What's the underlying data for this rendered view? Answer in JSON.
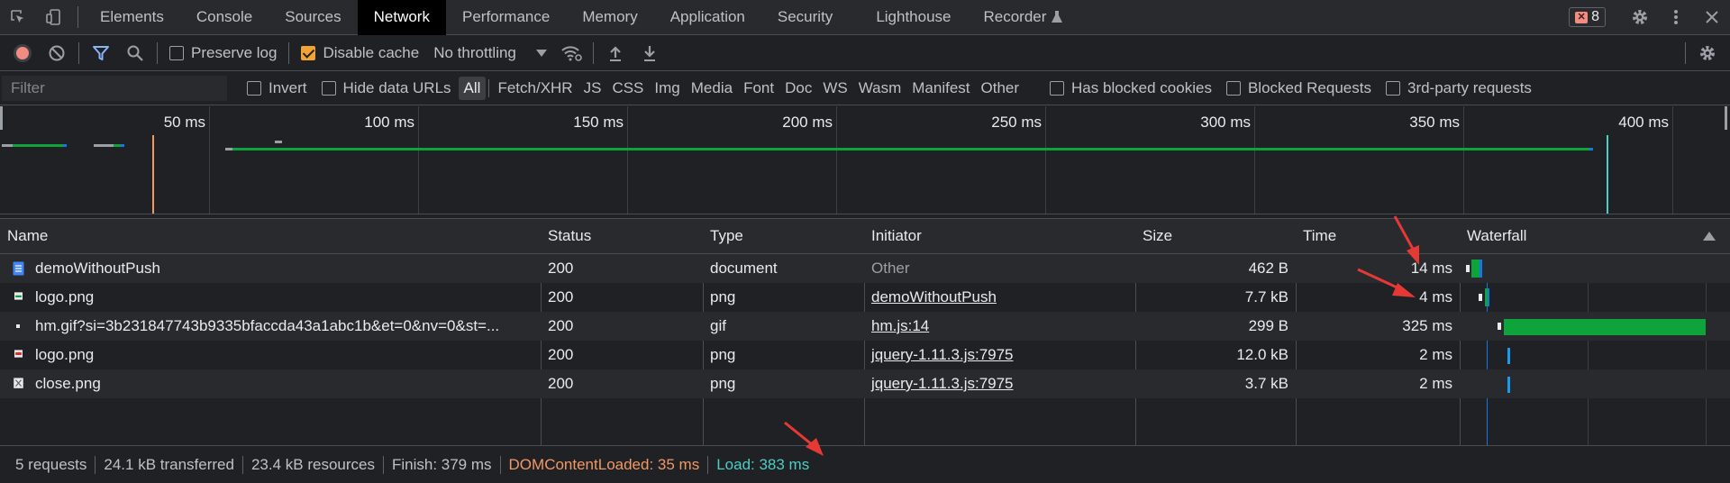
{
  "tabs": [
    {
      "label": "Elements",
      "name": "tab-elements"
    },
    {
      "label": "Console",
      "name": "tab-console"
    },
    {
      "label": "Sources",
      "name": "tab-sources"
    },
    {
      "label": "Network",
      "name": "tab-network"
    },
    {
      "label": "Performance",
      "name": "tab-performance"
    },
    {
      "label": "Memory",
      "name": "tab-memory"
    },
    {
      "label": "Application",
      "name": "tab-application"
    },
    {
      "label": "Security",
      "name": "tab-security"
    },
    {
      "label": "Lighthouse",
      "name": "tab-lighthouse"
    },
    {
      "label": "Recorder",
      "name": "tab-recorder"
    }
  ],
  "active_tab": "Network",
  "error_count": "8",
  "toolbar": {
    "preserve_log": "Preserve log",
    "disable_cache": "Disable cache",
    "throttling": "No throttling"
  },
  "filter": {
    "placeholder": "Filter",
    "invert": "Invert",
    "hide_data_urls": "Hide data URLs",
    "types": [
      "All",
      "Fetch/XHR",
      "JS",
      "CSS",
      "Img",
      "Media",
      "Font",
      "Doc",
      "WS",
      "Wasm",
      "Manifest",
      "Other"
    ],
    "has_blocked_cookies": "Has blocked cookies",
    "blocked_requests": "Blocked Requests",
    "third_party": "3rd-party requests"
  },
  "overview_ticks": [
    "50 ms",
    "100 ms",
    "150 ms",
    "200 ms",
    "250 ms",
    "300 ms",
    "350 ms",
    "400 ms"
  ],
  "columns": [
    "Name",
    "Status",
    "Type",
    "Initiator",
    "Size",
    "Time",
    "Waterfall"
  ],
  "rows": [
    {
      "name": "demoWithoutPush",
      "status": "200",
      "type": "document",
      "initiator": "Other",
      "size": "462 B",
      "time": "14 ms",
      "icon": "document-icon"
    },
    {
      "name": "logo.png",
      "status": "200",
      "type": "png",
      "initiator": "demoWithoutPush",
      "size": "7.7 kB",
      "time": "4 ms",
      "icon": "image-icon"
    },
    {
      "name": "hm.gif?si=3b231847743b9335bfaccda43a1abc1b&et=0&nv=0&st=...",
      "status": "200",
      "type": "gif",
      "initiator": "hm.js:14",
      "size": "299 B",
      "time": "325 ms",
      "icon": "gif-icon"
    },
    {
      "name": "logo.png",
      "status": "200",
      "type": "png",
      "initiator": "jquery-1.11.3.js:7975",
      "size": "12.0 kB",
      "time": "2 ms",
      "icon": "image-icon"
    },
    {
      "name": "close.png",
      "status": "200",
      "type": "png",
      "initiator": "jquery-1.11.3.js:7975",
      "size": "3.7 kB",
      "time": "2 ms",
      "icon": "close-image-icon"
    }
  ],
  "status": {
    "requests": "5 requests",
    "transferred": "24.1 kB transferred",
    "resources": "23.4 kB resources",
    "finish": "Finish: 379 ms",
    "dcl": "DOMContentLoaded: 35 ms",
    "load": "Load: 383 ms"
  },
  "colors": {
    "accent": "#8ab4f8",
    "record": "#f28b82",
    "checkbox_on": "#f2a336",
    "dcl": "#f29766",
    "load": "#4ecdc4",
    "bar_green": "#0fa33c"
  }
}
